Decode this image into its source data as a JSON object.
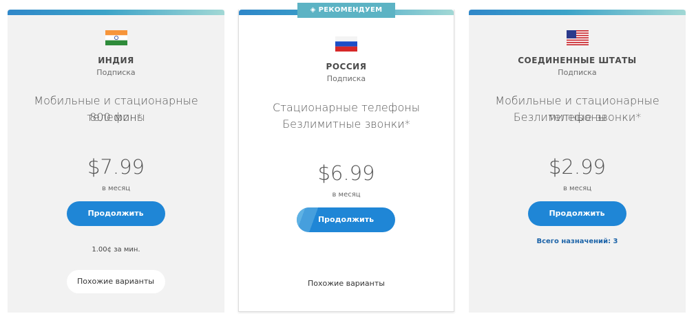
{
  "plans": [
    {
      "country": "ИНДИЯ",
      "subtitle": "Подписка",
      "desc_line1": "Мобильные и стационарные телефоны",
      "desc_line2": "800 мин*",
      "price": "$7.99",
      "per": "в месяц",
      "button": "Продолжить",
      "note": "1.00¢ за мин.",
      "similar": "Похожие варианты",
      "flag": "flag-india-icon"
    },
    {
      "badge": "РЕКОМЕНДУЕМ",
      "country": "РОССИЯ",
      "subtitle": "Подписка",
      "desc_line1": "Стационарные телефоны",
      "desc_line2": "Безлимитные звонки*",
      "price": "$6.99",
      "per": "в месяц",
      "button": "Продолжить",
      "similar": "Похожие варианты",
      "flag": "flag-russia-icon"
    },
    {
      "country": "СОЕДИНЕННЫЕ ШТАТЫ",
      "subtitle": "Подписка",
      "desc_line1": "Мобильные и стационарные телефоны",
      "desc_line2": "Безлимитные звонки*",
      "price": "$2.99",
      "per": "в месяц",
      "button": "Продолжить",
      "destinations": "Всего назначений: 3",
      "flag": "flag-usa-icon"
    }
  ],
  "colors": {
    "accent": "#1f86d6",
    "badge": "#5cb3c4",
    "link": "#1b63a8"
  }
}
